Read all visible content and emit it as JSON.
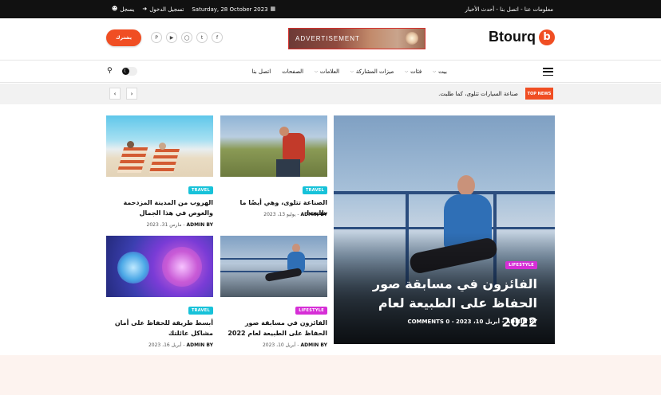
{
  "topbar": {
    "links": "معلومات عنا - اتصل بنا - أحدث الأخبار",
    "date": "Saturday, 28 October 2023",
    "login": "تسجيل الدخول",
    "register": "يسجل"
  },
  "header": {
    "logo_letter": "b",
    "logo_text": "Btourq",
    "ad_label": "ADVERTISEMENT",
    "subscribe_label": "يشترك",
    "socials": [
      "facebook-icon",
      "twitter-icon",
      "instagram-icon",
      "youtube-icon",
      "pinterest-icon"
    ]
  },
  "nav": {
    "items": [
      {
        "label": "بيت",
        "has_dropdown": true
      },
      {
        "label": "فئات",
        "has_dropdown": true
      },
      {
        "label": "ميزات المشاركة",
        "has_dropdown": true
      },
      {
        "label": "العلامات",
        "has_dropdown": true
      },
      {
        "label": "الصفحات",
        "has_dropdown": false
      },
      {
        "label": "اتصل بنا",
        "has_dropdown": false
      }
    ]
  },
  "ticker": {
    "tag": "TOP NEWS",
    "text": "صناعة السيارات تتلوى، كما طلبت."
  },
  "hero": {
    "badge": "LIFESTYLE",
    "title": "الفائزون في مسابقة صور الحفاظ على الطبيعة لعام 2022",
    "author": "ADMIN BY",
    "date": "أبريل 10، 2023",
    "comments": "COMMENTS 0",
    "badge_color": "#d62ed6"
  },
  "cards": [
    {
      "badge": "TRAVEL",
      "title": "الصناعة تتلوى، وهي أيضًا ما طلبت!",
      "author": "ADMIN BY",
      "date": "يوليو 13، 2023"
    },
    {
      "badge": "TRAVEL",
      "title": "الهروب من المدينة المزدحمة والغوص في هذا الجمال",
      "author": "ADMIN BY",
      "date": "مارس 31، 2023"
    },
    {
      "badge": "LIFESTYLE",
      "title": "الفائزون في مسابقة صور الحفاظ على الطبيعة لعام 2022",
      "author": "ADMIN BY",
      "date": "أبريل 10، 2023"
    },
    {
      "badge": "TRAVEL",
      "title": "أبسط طريقة للحفاظ على أمان مشاكل عائلتك",
      "author": "ADMIN BY",
      "date": "أبريل 16، 2023"
    }
  ],
  "colors": {
    "accent": "#f04e23",
    "travel": "#17c2d9",
    "lifestyle": "#d62ed6"
  }
}
